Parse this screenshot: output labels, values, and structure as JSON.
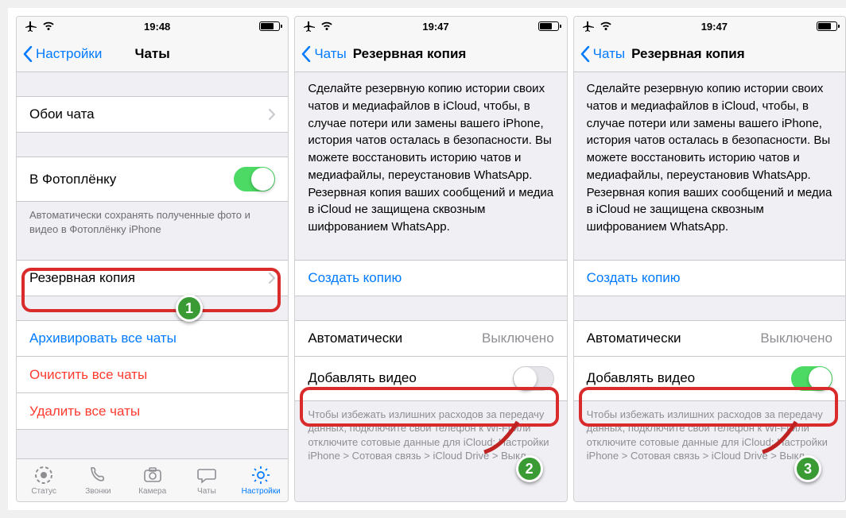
{
  "screens": {
    "a": {
      "time": "19:48",
      "back": "Настройки",
      "title": "Чаты",
      "wallpaper": "Обои чата",
      "camera_roll": "В Фотоплёнку",
      "camera_roll_note": "Автоматически сохранять полученные фото и видео в Фотоплёнку iPhone",
      "backup": "Резервная копия",
      "archive": "Архивировать все чаты",
      "clear": "Очистить все чаты",
      "delete": "Удалить все чаты",
      "tabs": {
        "status": "Статус",
        "calls": "Звонки",
        "camera": "Камера",
        "chats": "Чаты",
        "settings": "Настройки"
      }
    },
    "b": {
      "time": "19:47",
      "back": "Чаты",
      "title": "Резервная копия",
      "desc": "Сделайте резервную копию истории своих чатов и медиафайлов в iCloud, чтобы, в случае потери или замены вашего iPhone, история чатов осталась в безопасности. Вы можете восстановить историю чатов и медиафайлы, переустановив WhatsApp. Резервная копия ваших сообщений и медиа в iCloud не защищена сквозным шифрованием WhatsApp.",
      "create": "Создать копию",
      "auto": "Автоматически",
      "auto_value": "Выключено",
      "include_video": "Добавлять видео",
      "tip": "Чтобы избежать излишних расходов за передачу данных, подключите свой телефон к Wi-Fi или отключите сотовые данные для iCloud: Настройки iPhone > Сотовая связь > iCloud Drive > Выкл."
    }
  },
  "badges": {
    "one": "1",
    "two": "2",
    "three": "3"
  }
}
